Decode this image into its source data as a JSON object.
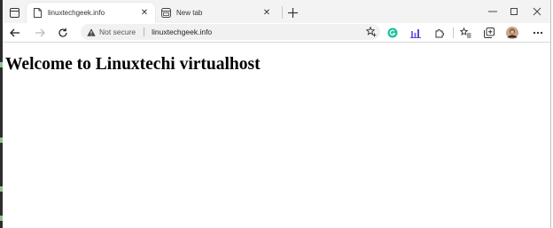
{
  "browser": {
    "tabs": [
      {
        "title": "linuxtechgeek.info",
        "active": true,
        "icon": "page-icon"
      },
      {
        "title": "New tab",
        "active": false,
        "icon": "new-tab-page-icon"
      }
    ],
    "address_bar": {
      "security_label": "Not secure",
      "url": "linuxtechgeek.info"
    },
    "toolbar_icons": [
      "back-icon",
      "forward-icon",
      "refresh-icon",
      "favorite-star-icon",
      "grammarly-extension-icon",
      "chart-extension-icon",
      "extensions-puzzle-icon",
      "favorites-icon",
      "collections-icon",
      "profile-avatar",
      "more-icon"
    ],
    "window_controls": [
      "minimize-icon",
      "maximize-icon",
      "close-window-icon"
    ]
  },
  "page": {
    "heading": "Welcome to Linuxtechi virtualhost"
  },
  "colors": {
    "grammarly_green": "#15c39a",
    "chart_purple": "#7b68ee",
    "tab_bar": "#f3f3f3"
  }
}
